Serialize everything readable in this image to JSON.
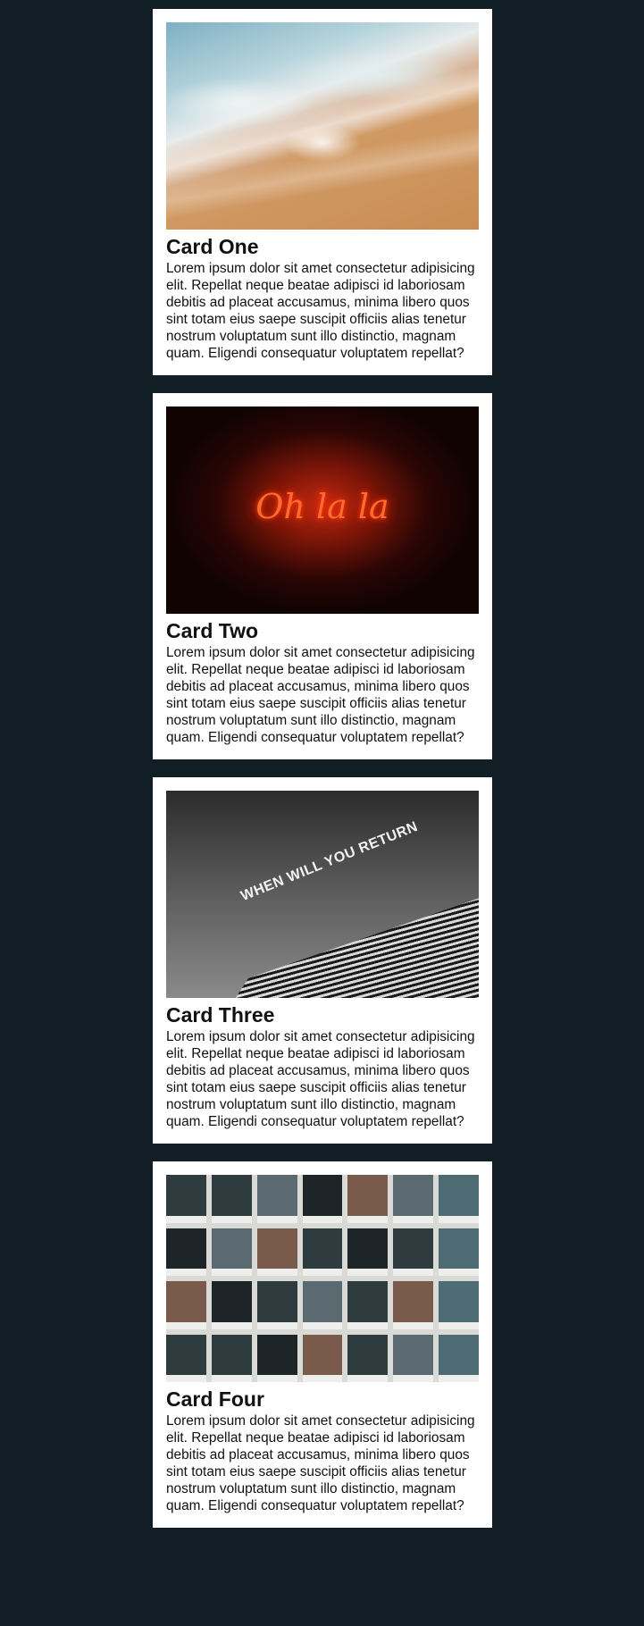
{
  "cards": [
    {
      "title": "Card One",
      "image": "beach-waves-photo",
      "text": "Lorem ipsum dolor sit amet consectetur adipisicing elit. Repellat neque beatae adipisci id laboriosam debitis ad placeat accusamus, minima libero quos sint totam eius saepe suscipit officiis alias tenetur nostrum voluptatum sunt illo distinctio, magnam quam. Eligendi consequatur voluptatem repellat?"
    },
    {
      "title": "Card Two",
      "image": "neon-sign-photo",
      "image_text": "Oh la la",
      "text": "Lorem ipsum dolor sit amet consectetur adipisicing elit. Repellat neque beatae adipisci id laboriosam debitis ad placeat accusamus, minima libero quos sint totam eius saepe suscipit officiis alias tenetur nostrum voluptatum sunt illo distinctio, magnam quam. Eligendi consequatur voluptatem repellat?"
    },
    {
      "title": "Card Three",
      "image": "building-sign-photo",
      "image_text": "WHEN WILL YOU RETURN",
      "text": "Lorem ipsum dolor sit amet consectetur adipisicing elit. Repellat neque beatae adipisci id laboriosam debitis ad placeat accusamus, minima libero quos sint totam eius saepe suscipit officiis alias tenetur nostrum voluptatum sunt illo distinctio, magnam quam. Eligendi consequatur voluptatem repellat?"
    },
    {
      "title": "Card Four",
      "image": "polaroid-grid-photo",
      "text": "Lorem ipsum dolor sit amet consectetur adipisicing elit. Repellat neque beatae adipisci id laboriosam debitis ad placeat accusamus, minima libero quos sint totam eius saepe suscipit officiis alias tenetur nostrum voluptatum sunt illo distinctio, magnam quam. Eligendi consequatur voluptatem repellat?"
    }
  ],
  "colors": {
    "background": "#111e25",
    "card": "#ffffff",
    "text": "#111111"
  }
}
